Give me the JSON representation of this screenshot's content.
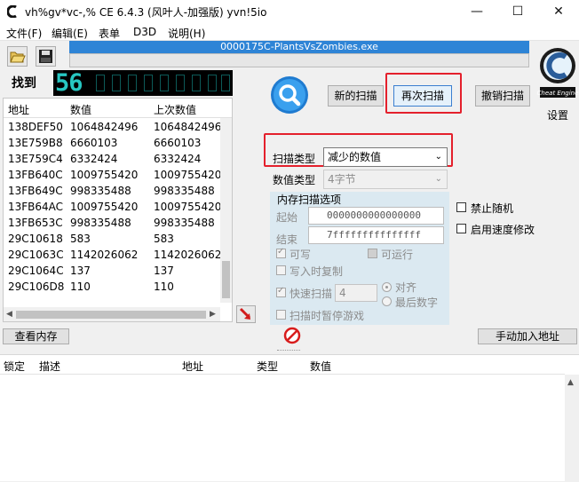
{
  "window": {
    "title": "vh%gv*vc-,%  CE 6.4.3 (风叶人-加强版)  yvn!5io",
    "process": "0000175C-PlantsVsZombies.exe",
    "minimize": "—",
    "maximize": "☐",
    "close": "✕"
  },
  "menu": [
    "文件(F)",
    "编辑(E)",
    "表单",
    "D3D",
    "说明(H)"
  ],
  "toolbar": {
    "open_icon": "folder-open-icon",
    "save_icon": "save-icon"
  },
  "found": {
    "label": "找到",
    "count": "56"
  },
  "results": {
    "columns": [
      "地址",
      "数值",
      "上次数值"
    ],
    "rows": [
      [
        "138DEF50",
        "1064842496",
        "1064842496"
      ],
      [
        "13E759B8",
        "6660103",
        "6660103"
      ],
      [
        "13E759C4",
        "6332424",
        "6332424"
      ],
      [
        "13FB640C",
        "1009755420",
        "1009755420"
      ],
      [
        "13FB649C",
        "998335488",
        "998335488"
      ],
      [
        "13FB64AC",
        "1009755420",
        "1009755420"
      ],
      [
        "13FB653C",
        "998335488",
        "998335488"
      ],
      [
        "29C10618",
        "583",
        "583"
      ],
      [
        "29C1063C",
        "1142026062",
        "1142026062"
      ],
      [
        "29C1064C",
        "137",
        "137"
      ],
      [
        "29C106D8",
        "110",
        "110"
      ]
    ]
  },
  "scan": {
    "new_scan": "新的扫描",
    "next_scan": "再次扫描",
    "undo_scan": "撤销扫描",
    "settings": "设置",
    "logo_caption": "Cheat Engine",
    "scan_type_label": "扫描类型",
    "scan_type_value": "减少的数值",
    "value_type_label": "数值类型",
    "value_type_value": "4字节"
  },
  "memory_options": {
    "title": "内存扫描选项",
    "start_label": "起始",
    "start_value": "0000000000000000",
    "end_label": "结束",
    "end_value": "7fffffffffffffff",
    "writable": "可写",
    "executable": "可运行",
    "copy_on_write": "写入时复制",
    "fast_scan": "快速扫描",
    "fast_scan_value": "4",
    "align": "对齐",
    "last_digits": "最后数字",
    "pause_game": "扫描时暂停游戏"
  },
  "side_options": {
    "unrandomizer": "禁止随机",
    "speedhack": "启用速度修改"
  },
  "bottom": {
    "view_memory": "查看内存",
    "add_manually": "手动加入地址"
  },
  "address_list": {
    "columns": [
      "锁定",
      "描述",
      "地址",
      "类型",
      "数值"
    ]
  },
  "colors": {
    "highlight_red": "#e4202c",
    "lcd_digit": "#27c7c2",
    "options_bg": "#dbe9f1"
  }
}
